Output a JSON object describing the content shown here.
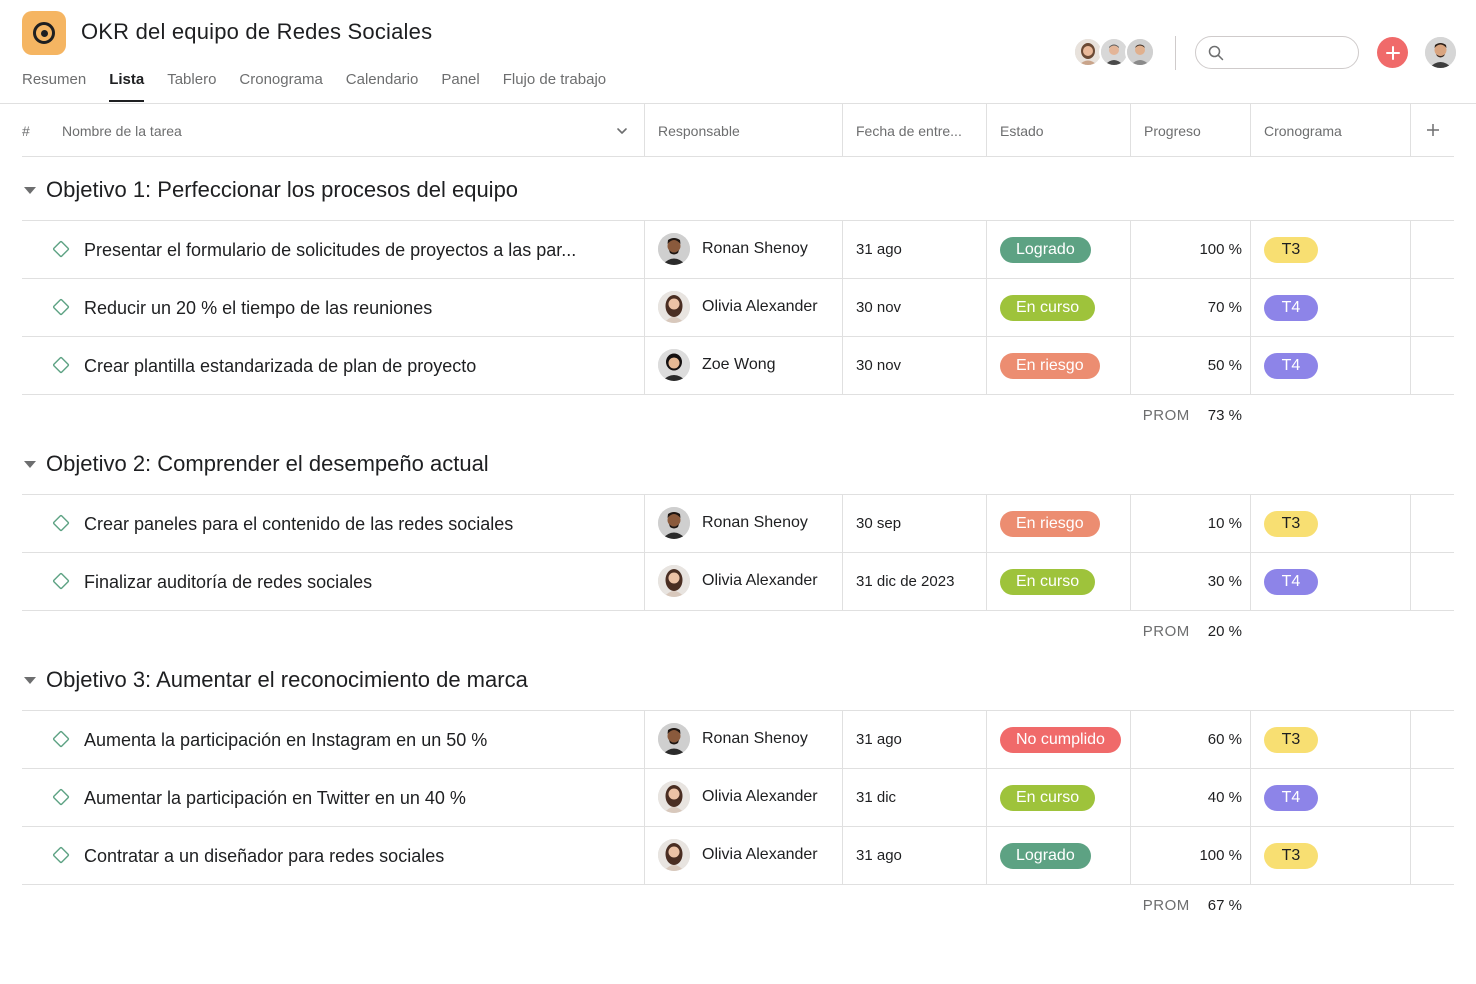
{
  "project": {
    "title": "OKR del equipo de Redes Sociales",
    "icon": "target-icon",
    "accent": "#f5b562"
  },
  "tabs": [
    {
      "label": "Resumen",
      "active": false
    },
    {
      "label": "Lista",
      "active": true
    },
    {
      "label": "Tablero",
      "active": false
    },
    {
      "label": "Cronograma",
      "active": false
    },
    {
      "label": "Calendario",
      "active": false
    },
    {
      "label": "Panel",
      "active": false
    },
    {
      "label": "Flujo de trabajo",
      "active": false
    }
  ],
  "columns": {
    "number": "#",
    "task_name": "Nombre de la tarea",
    "assignee": "Responsable",
    "due_date": "Fecha de entre...",
    "status": "Estado",
    "progress": "Progreso",
    "timeline": "Cronograma"
  },
  "status_colors": {
    "Logrado": "#5da283",
    "En curso": "#9ec33b",
    "En riesgo": "#ec8d71",
    "No cumplido": "#f06a6a"
  },
  "quarter_colors": {
    "T3": {
      "bg": "#f8df72",
      "fg": "#1e1f21"
    },
    "T4": {
      "bg": "#8d84e8",
      "fg": "#ffffff"
    }
  },
  "avg_label": "PROM",
  "sections": [
    {
      "title": "Objetivo 1: Perfeccionar los procesos del equipo",
      "average": "73 %",
      "tasks": [
        {
          "name": "Presentar el formulario de solicitudes de proyectos a las par...",
          "assignee": "Ronan Shenoy",
          "due": "31 ago",
          "status": "Logrado",
          "progress": "100 %",
          "quarter": "T3"
        },
        {
          "name": "Reducir un 20 % el tiempo de las reuniones",
          "assignee": "Olivia Alexander",
          "due": "30 nov",
          "status": "En curso",
          "progress": "70 %",
          "quarter": "T4"
        },
        {
          "name": "Crear plantilla estandarizada de plan de proyecto",
          "assignee": "Zoe Wong",
          "due": "30 nov",
          "status": "En riesgo",
          "progress": "50 %",
          "quarter": "T4"
        }
      ]
    },
    {
      "title": "Objetivo 2: Comprender el desempeño actual",
      "average": "20 %",
      "tasks": [
        {
          "name": "Crear paneles para el contenido de las redes sociales",
          "assignee": "Ronan Shenoy",
          "due": "30 sep",
          "status": "En riesgo",
          "progress": "10 %",
          "quarter": "T3"
        },
        {
          "name": "Finalizar auditoría de redes sociales",
          "assignee": "Olivia Alexander",
          "due": "31 dic de 2023",
          "status": "En curso",
          "progress": "30 %",
          "quarter": "T4"
        }
      ]
    },
    {
      "title": "Objetivo 3: Aumentar el reconocimiento de marca",
      "average": "67 %",
      "tasks": [
        {
          "name": "Aumenta la participación en Instagram en un 50 %",
          "assignee": "Ronan Shenoy",
          "due": "31 ago",
          "status": "No cumplido",
          "progress": "60 %",
          "quarter": "T3"
        },
        {
          "name": "Aumentar la participación en Twitter en un 40 %",
          "assignee": "Olivia Alexander",
          "due": "31 dic",
          "status": "En curso",
          "progress": "40 %",
          "quarter": "T4"
        },
        {
          "name": "Contratar a un diseñador para redes sociales",
          "assignee": "Olivia Alexander",
          "due": "31 ago",
          "status": "Logrado",
          "progress": "100 %",
          "quarter": "T3"
        }
      ]
    }
  ]
}
